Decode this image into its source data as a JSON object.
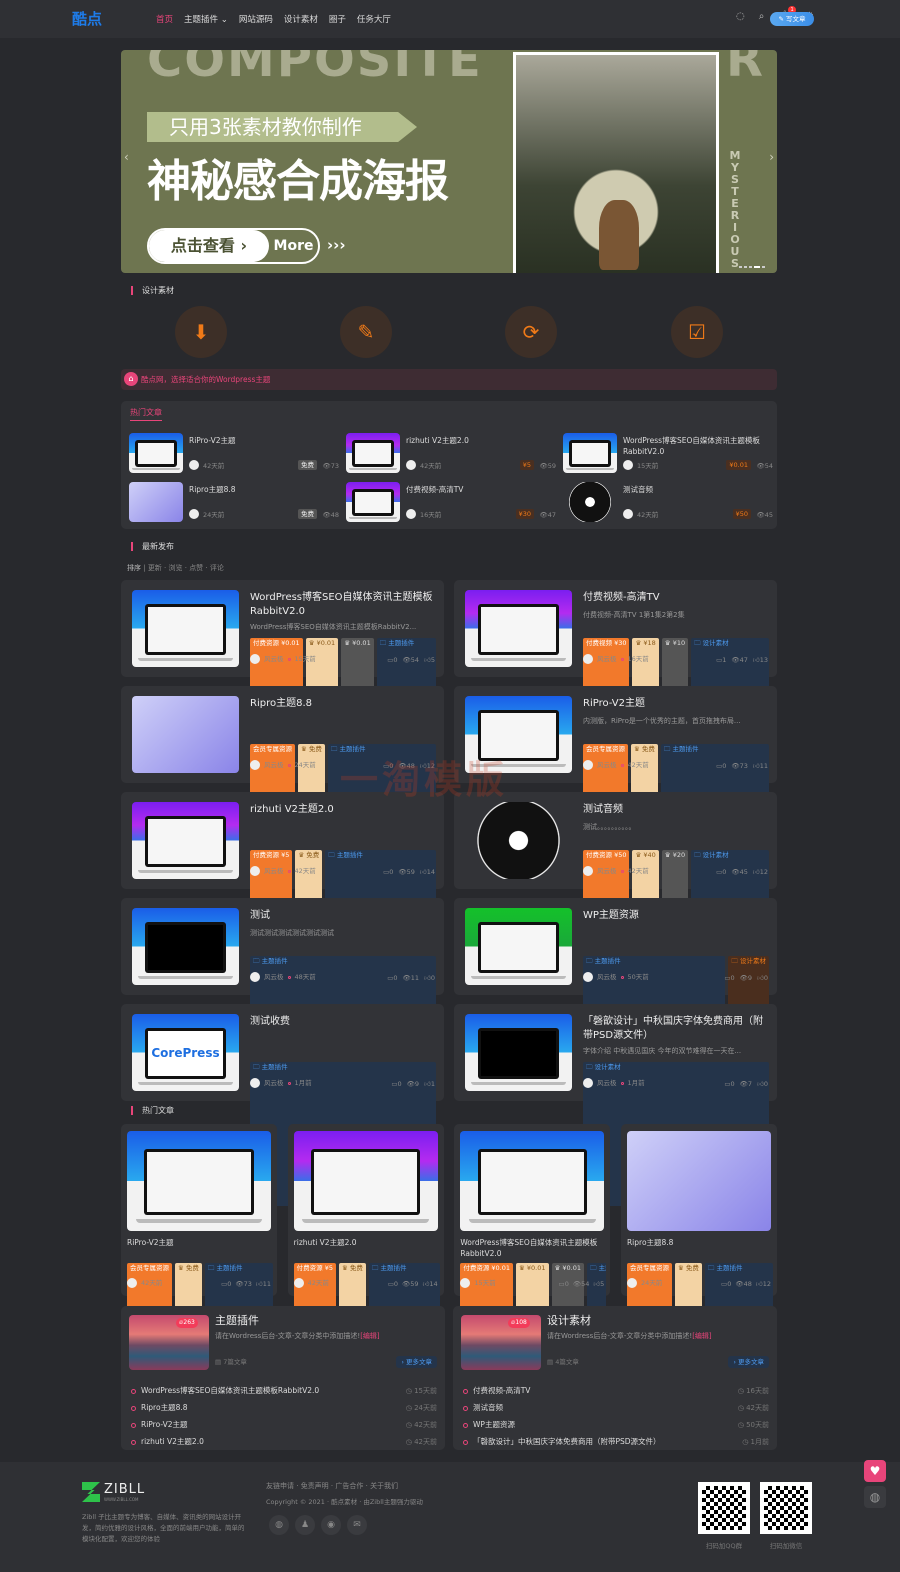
{
  "nav": {
    "logo": "酷点",
    "items": [
      "首页",
      "主题插件",
      "网站源码",
      "设计素材",
      "圈子",
      "任务大厅"
    ],
    "active": 0,
    "notif_count": "1",
    "write_label": "写文章"
  },
  "banner": {
    "bg_word": "COMPOSITE",
    "bg_letter": "R",
    "subtitle": "只用3张素材教你制作",
    "title": "神秘感合成海报",
    "btn": "点击查看 ›",
    "more": "More",
    "arrows": "›››",
    "side": "MYSTERIOUS",
    "slides": 5,
    "active_slide": 4
  },
  "section1": {
    "title": "设计素材",
    "icons": [
      "download-icon",
      "pencil-icon",
      "refresh-icon",
      "checkbox-icon"
    ]
  },
  "notice": "酷点网，选择适合你的Wordpress主题",
  "hot_mini": {
    "tab": "热门文章",
    "items": [
      {
        "title": "RiPro-V2主题",
        "time": "42天前",
        "price": "免费",
        "price_type": "free",
        "views": "73",
        "thumb": "blue"
      },
      {
        "title": "rizhuti V2主题2.0",
        "time": "42天前",
        "price": "¥5",
        "price_type": "pay",
        "views": "59",
        "thumb": "purple"
      },
      {
        "title": "WordPress博客SEO自媒体资讯主题模板RabbitV2.0",
        "time": "15天前",
        "price": "¥0.01",
        "price_type": "pay",
        "views": "54",
        "thumb": "blue"
      },
      {
        "title": "Ripro主题8.8",
        "time": "24天前",
        "price": "免费",
        "price_type": "free",
        "views": "48",
        "thumb": "lav"
      },
      {
        "title": "付费视频-高清TV",
        "time": "16天前",
        "price": "¥30",
        "price_type": "pay",
        "views": "47",
        "thumb": "purple"
      },
      {
        "title": "测试音频",
        "time": "42天前",
        "price": "¥50",
        "price_type": "pay",
        "views": "45",
        "thumb": "vinyl"
      }
    ]
  },
  "latest": {
    "title": "最新发布",
    "sort_label": "排序",
    "sorts": [
      "更新",
      "浏览",
      "点赞",
      "评论"
    ],
    "posts": [
      {
        "title": "WordPress博客SEO自媒体资讯主题模板RabbitV2.0",
        "desc": "WordPress博客SEO自媒体资讯主题模板RabbitV2...",
        "badges": [
          {
            "t": "付费资源 ¥0.01",
            "k": "pay"
          },
          {
            "t": "♛ ¥0.01",
            "k": "vip"
          },
          {
            "t": "♛ ¥0.01",
            "k": "svip"
          },
          {
            "t": "🗀 主题插件",
            "k": "cat"
          }
        ],
        "author": "风云极",
        "time": "15天前",
        "comments": "0",
        "views": "54",
        "likes": "5",
        "thumb": "blue"
      },
      {
        "title": "付费视频-高清TV",
        "desc": "付费视频-高清TV 1第1集2第2集",
        "badges": [
          {
            "t": "付费视频 ¥30",
            "k": "pay"
          },
          {
            "t": "♛ ¥18",
            "k": "vip"
          },
          {
            "t": "♛ ¥10",
            "k": "svip"
          },
          {
            "t": "🗀 设计素材",
            "k": "cat"
          }
        ],
        "author": "风云极",
        "time": "16天前",
        "comments": "1",
        "views": "47",
        "likes": "13",
        "thumb": "purple"
      },
      {
        "title": "Ripro主题8.8",
        "desc": "",
        "badges": [
          {
            "t": "会员专属资源",
            "k": "pay"
          },
          {
            "t": "♛ 免费",
            "k": "vip"
          },
          {
            "t": "🗀 主题插件",
            "k": "cat"
          }
        ],
        "author": "风云极",
        "time": "24天前",
        "comments": "0",
        "views": "48",
        "likes": "12",
        "thumb": "lav"
      },
      {
        "title": "RiPro-V2主题",
        "desc": "内测版，RiPro是一个优秀的主题，首页拖拽布局...",
        "badges": [
          {
            "t": "会员专属资源",
            "k": "pay"
          },
          {
            "t": "♛ 免费",
            "k": "vip"
          },
          {
            "t": "🗀 主题插件",
            "k": "cat"
          }
        ],
        "author": "风云极",
        "time": "42天前",
        "comments": "0",
        "views": "73",
        "likes": "11",
        "thumb": "blue"
      },
      {
        "title": "rizhuti V2主题2.0",
        "desc": "",
        "badges": [
          {
            "t": "付费资源 ¥5",
            "k": "pay"
          },
          {
            "t": "♛ 免费",
            "k": "vip"
          },
          {
            "t": "🗀 主题插件",
            "k": "cat"
          }
        ],
        "author": "风云极",
        "time": "42天前",
        "comments": "0",
        "views": "59",
        "likes": "14",
        "thumb": "purple"
      },
      {
        "title": "测试音频",
        "desc": "测试。。。。。。。。。。",
        "badges": [
          {
            "t": "付费资源 ¥50",
            "k": "pay"
          },
          {
            "t": "♛ ¥40",
            "k": "vip"
          },
          {
            "t": "♛ ¥20",
            "k": "svip"
          },
          {
            "t": "🗀 设计素材",
            "k": "cat"
          }
        ],
        "author": "风云极",
        "time": "42天前",
        "comments": "0",
        "views": "45",
        "likes": "12",
        "thumb": "vinyl"
      },
      {
        "title": "测试",
        "desc": "测试测试测试测试测试测试",
        "badges": [
          {
            "t": "🗀 主题插件",
            "k": "cat"
          }
        ],
        "author": "风云极",
        "time": "48天前",
        "comments": "0",
        "views": "11",
        "likes": "0",
        "thumb": "blue-dark"
      },
      {
        "title": "WP主题资源",
        "desc": "",
        "badges": [
          {
            "t": "🗀 主题插件",
            "k": "cat"
          },
          {
            "t": "🗀 设计素材",
            "k": "cato"
          }
        ],
        "author": "风云极",
        "time": "50天前",
        "comments": "0",
        "views": "9",
        "likes": "0",
        "thumb": "green"
      },
      {
        "title": "测试收费",
        "desc": "",
        "badges": [
          {
            "t": "🗀 主题插件",
            "k": "cat"
          }
        ],
        "author": "风云极",
        "time": "1月前",
        "comments": "0",
        "views": "9",
        "likes": "1",
        "thumb": "core",
        "thumb_text": "CorePress"
      },
      {
        "title": "「磬歆设计」中秋国庆字体免费商用（附带PSD源文件）",
        "desc": "字体介绍 中秋遇见国庆 今年的双节难得在一天在...",
        "badges": [
          {
            "t": "🗀 设计素材",
            "k": "cat"
          }
        ],
        "author": "风云极",
        "time": "1月前",
        "comments": "0",
        "views": "7",
        "likes": "0",
        "thumb": "blue-dark"
      }
    ]
  },
  "hot": {
    "title": "热门文章",
    "cards": [
      {
        "title": "RiPro-V2主题",
        "badges": [
          {
            "t": "会员专属资源",
            "k": "pay"
          },
          {
            "t": "♛ 免费",
            "k": "vip"
          },
          {
            "t": "🗀 主题插件",
            "k": "cat"
          }
        ],
        "time": "42天前",
        "comments": "0",
        "views": "73",
        "likes": "11",
        "thumb": "blue"
      },
      {
        "title": "rizhuti V2主题2.0",
        "badges": [
          {
            "t": "付费资源 ¥5",
            "k": "pay"
          },
          {
            "t": "♛ 免费",
            "k": "vip"
          },
          {
            "t": "🗀 主题插件",
            "k": "cat"
          }
        ],
        "time": "42天前",
        "comments": "0",
        "views": "59",
        "likes": "14",
        "thumb": "purple"
      },
      {
        "title": "WordPress博客SEO自媒体资讯主题模板RabbitV2.0",
        "badges": [
          {
            "t": "付费资源 ¥0.01",
            "k": "pay"
          },
          {
            "t": "♛ ¥0.01",
            "k": "vip"
          },
          {
            "t": "♛ ¥0.01",
            "k": "svip"
          },
          {
            "t": "🗀 主题插件",
            "k": "cat"
          }
        ],
        "time": "15天前",
        "comments": "0",
        "views": "54",
        "likes": "5",
        "thumb": "blue"
      },
      {
        "title": "Ripro主题8.8",
        "badges": [
          {
            "t": "会员专属资源",
            "k": "pay"
          },
          {
            "t": "♛ 免费",
            "k": "vip"
          },
          {
            "t": "🗀 主题插件",
            "k": "cat"
          }
        ],
        "time": "24天前",
        "comments": "0",
        "views": "48",
        "likes": "12",
        "thumb": "lav"
      }
    ]
  },
  "categories": [
    {
      "name": "主题插件",
      "hot": "263",
      "desc": "请在Wordress后台-文章-文章分类中添加描述!",
      "edit": "[编辑]",
      "count": "7篇文章",
      "more": "› 更多文章",
      "posts": [
        {
          "t": "WordPress博客SEO自媒体资讯主题模板RabbitV2.0",
          "time": "15天前"
        },
        {
          "t": "Ripro主题8.8",
          "time": "24天前"
        },
        {
          "t": "RiPro-V2主题",
          "time": "42天前"
        },
        {
          "t": "rizhuti V2主题2.0",
          "time": "42天前"
        }
      ]
    },
    {
      "name": "设计素材",
      "hot": "108",
      "desc": "请在Wordress后台-文章-文章分类中添加描述!",
      "edit": "[编辑]",
      "count": "4篇文章",
      "more": "› 更多文章",
      "posts": [
        {
          "t": "付费视频-高清TV",
          "time": "16天前"
        },
        {
          "t": "测试音频",
          "time": "42天前"
        },
        {
          "t": "WP主题资源",
          "time": "50天前"
        },
        {
          "t": "「磬歆设计」中秋国庆字体免费商用（附带PSD源文件）",
          "time": "1月前"
        }
      ]
    }
  ],
  "watermark": "一淘模版",
  "footer": {
    "logo": "ZIBLL",
    "logo_sub": "WWW.ZIBLL.COM",
    "about": "Zibll 子比主题专为博客、自媒体、资讯类的网站设计开发，简约优雅的设计风格，全面的前端用户功能，简单的模块化配置，欢迎您的体验",
    "links": [
      "友链申请",
      "免责声明",
      "广告合作",
      "关于我们"
    ],
    "copyright": "Copyright © 2021 · 酷点素材 · 由Zibll主题强力驱动",
    "qr": [
      "扫码加QQ群",
      "扫码加微信"
    ]
  },
  "colors": {
    "accent": "#e8457a",
    "orange": "#f07a18",
    "blue": "#4d9aee",
    "bg": "#28292d",
    "card": "#323337"
  }
}
